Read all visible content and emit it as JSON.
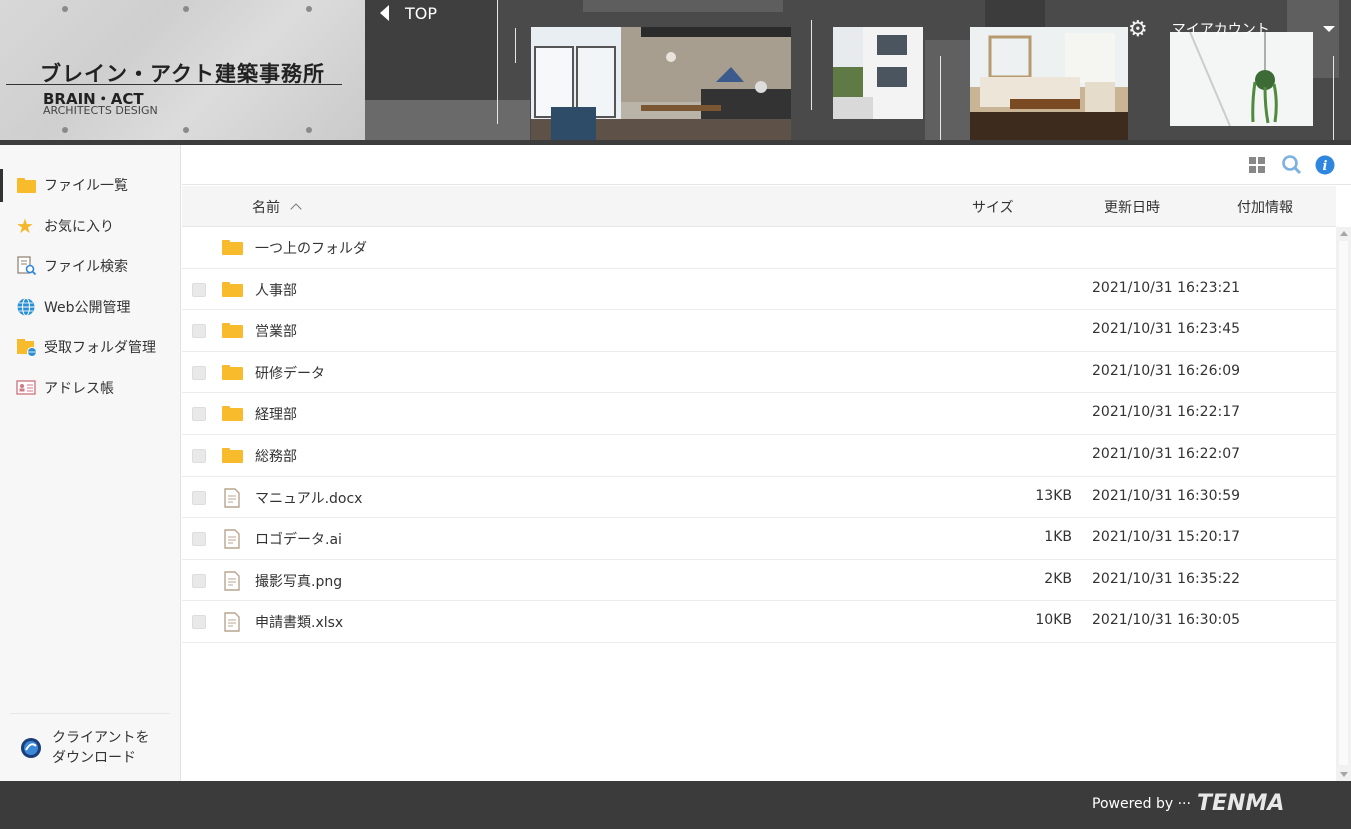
{
  "brand": {
    "name_jp": "ブレイン・アクト建築事務所",
    "name_en": "BRAIN・ACT",
    "subtitle_en": "ARCHITECTS DESIGN"
  },
  "header": {
    "top_label": "TOP",
    "account_label": "マイアカウント"
  },
  "sidebar": {
    "items": [
      {
        "label": "ファイル一覧",
        "icon": "folder-icon",
        "active": true
      },
      {
        "label": "お気に入り",
        "icon": "star-icon"
      },
      {
        "label": "ファイル検索",
        "icon": "file-search-icon"
      },
      {
        "label": "Web公開管理",
        "icon": "globe-icon"
      },
      {
        "label": "受取フォルダ管理",
        "icon": "receive-folder-icon"
      },
      {
        "label": "アドレス帳",
        "icon": "address-book-icon"
      }
    ],
    "client_download": {
      "line1": "クライアントを",
      "line2": "ダウンロード"
    }
  },
  "table": {
    "headers": {
      "name": "名前",
      "size": "サイズ",
      "modified": "更新日時",
      "extra": "付加情報"
    },
    "parent_folder": "一つ上のフォルダ",
    "rows": [
      {
        "type": "folder",
        "name": "人事部",
        "size": "",
        "date": "2021/10/31 16:23:21"
      },
      {
        "type": "folder",
        "name": "営業部",
        "size": "",
        "date": "2021/10/31 16:23:45"
      },
      {
        "type": "folder",
        "name": "研修データ",
        "size": "",
        "date": "2021/10/31 16:26:09"
      },
      {
        "type": "folder",
        "name": "経理部",
        "size": "",
        "date": "2021/10/31 16:22:17"
      },
      {
        "type": "folder",
        "name": "総務部",
        "size": "",
        "date": "2021/10/31 16:22:07"
      },
      {
        "type": "file",
        "name": "マニュアル.docx",
        "size": "13KB",
        "date": "2021/10/31 16:30:59"
      },
      {
        "type": "file",
        "name": "ロゴデータ.ai",
        "size": "1KB",
        "date": "2021/10/31 15:20:17"
      },
      {
        "type": "file",
        "name": "撮影写真.png",
        "size": "2KB",
        "date": "2021/10/31 16:35:22"
      },
      {
        "type": "file",
        "name": "申請書類.xlsx",
        "size": "10KB",
        "date": "2021/10/31 16:30:05"
      }
    ]
  },
  "footer": {
    "powered_by": "Powered by ···",
    "vendor": "TENMA"
  },
  "colors": {
    "folder": "#f7bb2b",
    "accent_blue": "#2e86de",
    "header_bg": "#555555",
    "footer_bg": "#3b3b3b"
  }
}
